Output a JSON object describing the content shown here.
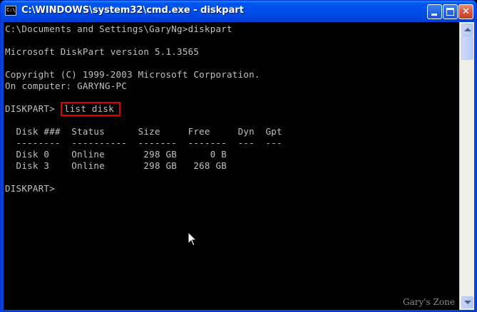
{
  "window": {
    "title": "C:\\WINDOWS\\system32\\cmd.exe - diskpart",
    "icon_text": "C:\\",
    "close_glyph": "✕"
  },
  "console": {
    "lines": [
      "C:\\Documents and Settings\\GaryNg>diskpart",
      "",
      "Microsoft DiskPart version 5.1.3565",
      "",
      "Copyright (C) 1999-2003 Microsoft Corporation.",
      "On computer: GARYNG-PC",
      "",
      "DISKPART> ",
      "",
      "  Disk ###  Status      Size     Free     Dyn  Gpt",
      "  --------  ----------  -------  -------  ---  ---",
      "  Disk 0    Online       298 GB      0 B",
      "  Disk 3    Online       298 GB   268 GB",
      "",
      "DISKPART> "
    ],
    "highlighted_command": "list disk"
  },
  "watermark": "Gary's Zone",
  "colors": {
    "console_text": "#c0c0c0",
    "console_bg": "#000000",
    "titlebar": "#0050ee",
    "highlight": "#e30000"
  }
}
